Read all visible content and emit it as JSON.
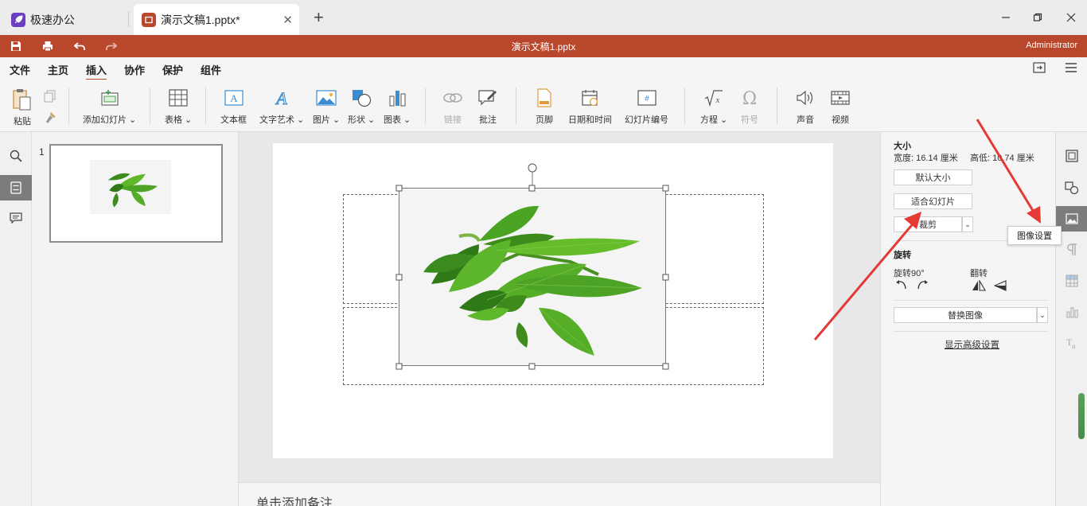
{
  "tabs": [
    {
      "label": "极速办公",
      "icon": "rocket-icon",
      "color": "#6a3fc2"
    },
    {
      "label": "演示文稿1.pptx*",
      "icon": "presentation-icon",
      "color": "#b8472c"
    }
  ],
  "titlebar": {
    "title": "演示文稿1.pptx",
    "user": "Administrator",
    "color": "#b8472c"
  },
  "menu": [
    "文件",
    "主页",
    "插入",
    "协作",
    "保护",
    "组件"
  ],
  "menu_active": "插入",
  "ribbon": {
    "paste": "粘贴",
    "add_slide": "添加幻灯片",
    "table": "表格",
    "textbox": "文本框",
    "wordart": "文字艺术",
    "picture": "图片",
    "shape": "形状",
    "chart": "图表",
    "link": "链接",
    "comment": "批注",
    "footer": "页脚",
    "datetime": "日期和时间",
    "slide_number": "幻灯片编号",
    "equation": "方程",
    "symbol": "符号",
    "audio": "声音",
    "video": "视频"
  },
  "thumbnail": {
    "number": "1"
  },
  "notes_placeholder": "单击添加备注",
  "panel": {
    "size_title": "大小",
    "width_label": "宽度: 16.14 厘米",
    "height_label": "高低: 10.74 厘米",
    "default_size": "默认大小",
    "fit_slide": "适合幻灯片",
    "crop": "裁剪",
    "rotation_title": "旋转",
    "rotate90": "旋转90°",
    "flip": "翻转",
    "replace_image": "替换图像",
    "advanced": "显示高级设置"
  },
  "tooltip": "图像设置",
  "accent_color": "#b8472c",
  "arrow_color": "#e53935"
}
